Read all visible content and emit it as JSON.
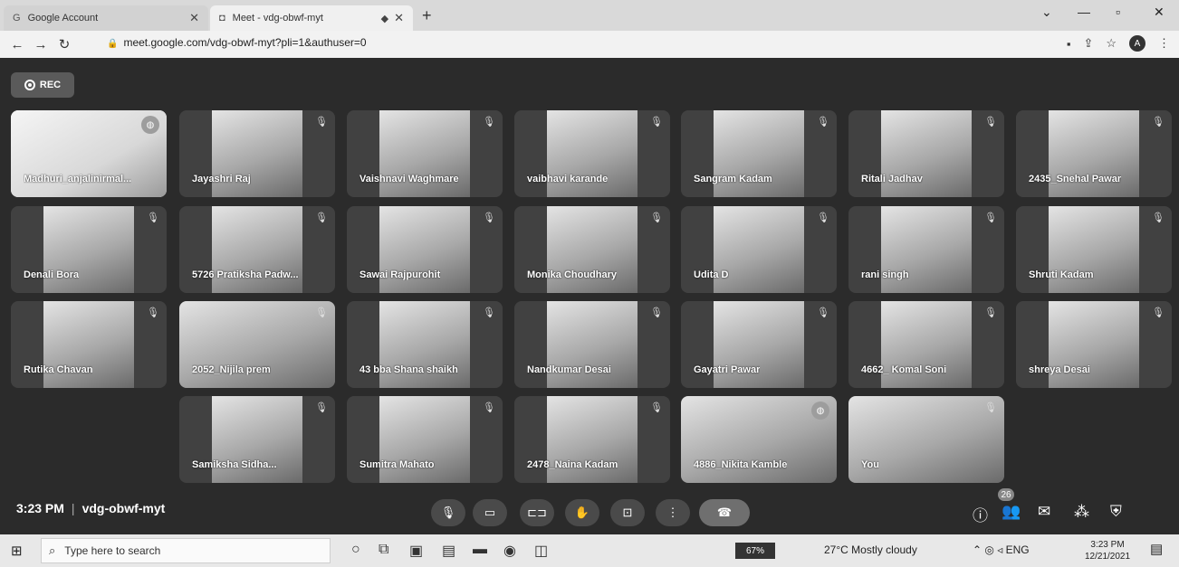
{
  "browser": {
    "tabs": [
      {
        "title": "Google Account",
        "favicon": "G"
      },
      {
        "title": "Meet - vdg-obwf-myt",
        "favicon": "◘"
      }
    ],
    "url": "meet.google.com/vdg-obwf-myt?pli=1&authuser=0",
    "profile_initial": "A"
  },
  "meet": {
    "rec_label": "REC",
    "participants": [
      {
        "name": "Madhuri_anjalinirmal...",
        "style": "light",
        "active": true
      },
      {
        "name": "Jayashri Raj",
        "style": "normal"
      },
      {
        "name": "Vaishnavi Waghmare",
        "style": "normal"
      },
      {
        "name": "vaibhavi karande",
        "style": "normal"
      },
      {
        "name": "Sangram Kadam",
        "style": "normal"
      },
      {
        "name": "Ritali Jadhav",
        "style": "normal"
      },
      {
        "name": "2435_Snehal Pawar",
        "style": "normal"
      },
      {
        "name": "Denali Bora",
        "style": "normal"
      },
      {
        "name": "5726 Pratiksha Padw...",
        "style": "normal"
      },
      {
        "name": "Sawai Rajpurohit",
        "style": "normal"
      },
      {
        "name": "Monika Choudhary",
        "style": "normal"
      },
      {
        "name": "Udita D",
        "style": "normal"
      },
      {
        "name": "rani singh",
        "style": "normal"
      },
      {
        "name": "Shruti Kadam",
        "style": "normal"
      },
      {
        "name": "Rutika Chavan",
        "style": "normal"
      },
      {
        "name": "2052_Nijila prem",
        "style": "wide"
      },
      {
        "name": "43 bba Shana shaikh",
        "style": "normal"
      },
      {
        "name": "Nandkumar Desai",
        "style": "normal"
      },
      {
        "name": "Gayatri Pawar",
        "style": "normal"
      },
      {
        "name": "4662_ Komal Soni",
        "style": "normal"
      },
      {
        "name": "shreya Desai",
        "style": "normal"
      },
      {
        "name": "Samiksha Sidha...",
        "style": "normal"
      },
      {
        "name": "Sumitra Mahato",
        "style": "normal"
      },
      {
        "name": "2478_Naina Kadam",
        "style": "normal"
      },
      {
        "name": "4886_Nikita Kamble",
        "style": "wide",
        "active": true
      },
      {
        "name": "You",
        "style": "wide"
      }
    ],
    "time": "3:23 PM",
    "meeting_code": "vdg-obwf-myt",
    "participant_count": "26"
  },
  "taskbar": {
    "search_placeholder": "Type here to search",
    "battery": "67%",
    "weather": "27°C  Mostly cloudy",
    "lang": "ENG",
    "time": "3:23 PM",
    "date": "12/21/2021"
  }
}
